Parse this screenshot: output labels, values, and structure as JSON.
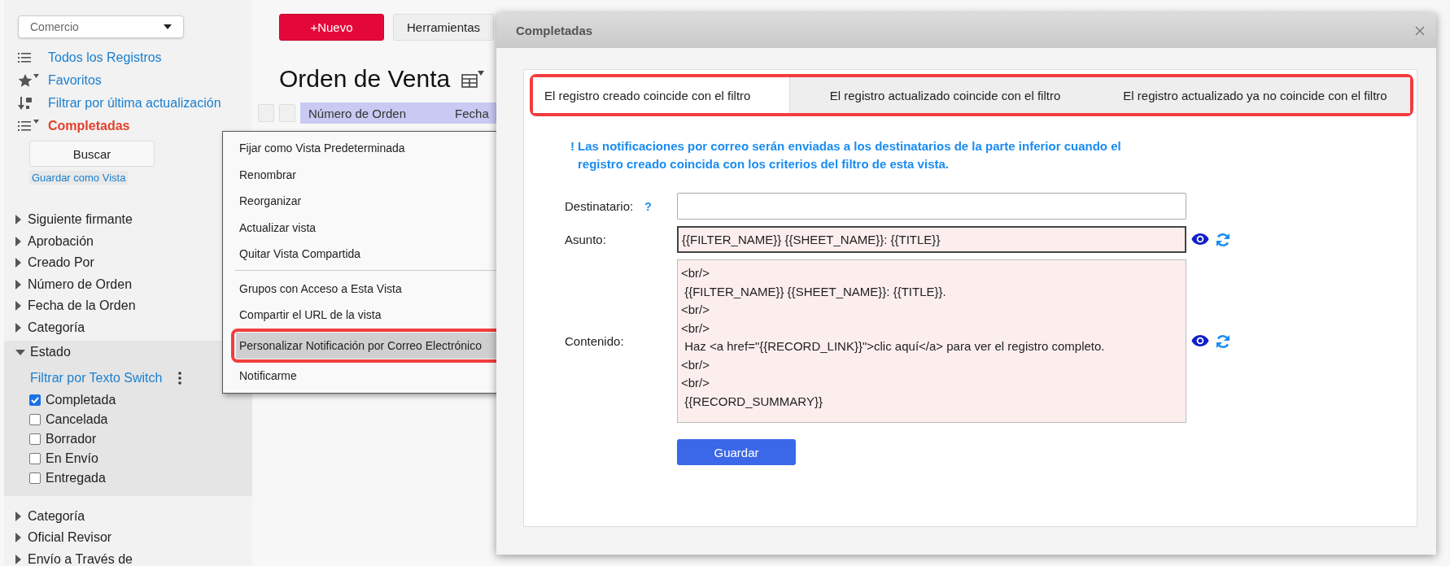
{
  "sidebar": {
    "app_select": {
      "value": "Comercio"
    },
    "views": [
      {
        "label": "Todos los Registros",
        "kind": "list",
        "selected": false
      },
      {
        "label": "Favoritos",
        "kind": "favorites",
        "selected": false
      },
      {
        "label": "Filtrar por última actualización",
        "kind": "sort",
        "selected": false
      },
      {
        "label": "Completadas",
        "kind": "filter-list",
        "selected": true
      }
    ],
    "search_button": "Buscar",
    "save_view_link": "Guardar como Vista",
    "filters": [
      {
        "label": "Siguiente firmante",
        "expanded": false
      },
      {
        "label": "Aprobación",
        "expanded": false
      },
      {
        "label": "Creado Por",
        "expanded": false
      },
      {
        "label": "Número de Orden",
        "expanded": false
      },
      {
        "label": "Fecha de la Orden",
        "expanded": false
      },
      {
        "label": "Categoría",
        "expanded": false
      },
      {
        "label": "Estado",
        "expanded": true,
        "filter_mode": "Filtrar por Texto Switch",
        "options": [
          {
            "label": "Completada",
            "checked": true
          },
          {
            "label": "Cancelada",
            "checked": false
          },
          {
            "label": "Borrador",
            "checked": false
          },
          {
            "label": "En Envío",
            "checked": false
          },
          {
            "label": "Entregada",
            "checked": false
          }
        ]
      },
      {
        "label": "Categoría",
        "expanded": false
      },
      {
        "label": "Oficial Revisor",
        "expanded": false
      },
      {
        "label": "Envío a Través de",
        "expanded": false
      }
    ]
  },
  "main": {
    "new_button": "+Nuevo",
    "tools_button": "Herramientas",
    "title": "Orden de Venta",
    "table_columns": [
      "Número de Orden",
      "Fecha"
    ]
  },
  "context_menu": {
    "groups": [
      [
        {
          "label": "Fijar como Vista Predeterminada",
          "selected": false
        },
        {
          "label": "Renombrar",
          "selected": false
        },
        {
          "label": "Reorganizar",
          "selected": false
        },
        {
          "label": "Actualizar vista",
          "selected": false
        },
        {
          "label": "Quitar Vista Compartida",
          "selected": false
        }
      ],
      [
        {
          "label": "Grupos con Acceso a Esta Vista",
          "selected": false
        },
        {
          "label": "Compartir el URL de la vista",
          "selected": false
        },
        {
          "label": "Personalizar Notificación por Correo Electrónico",
          "selected": true
        },
        {
          "label": "Notificarme",
          "selected": false
        }
      ]
    ]
  },
  "dialog": {
    "title": "Completadas",
    "tabs_highlighted": true,
    "tabs": [
      {
        "label": "El registro creado coincide con el filtro",
        "selected": true
      },
      {
        "label": "El registro actualizado coincide con el filtro",
        "selected": false
      },
      {
        "label": "El registro actualizado ya no coincide con el filtro",
        "selected": false
      }
    ],
    "notice_mark": "!",
    "notice": "Las notificaciones por correo serán enviadas a los destinatarios de la parte inferior cuando el registro creado coincida con los criterios del filtro de esta vista.",
    "fields": [
      {
        "label": "Destinatario:",
        "kind": "recipient",
        "help": "?"
      },
      {
        "label": "Asunto:",
        "kind": "subject",
        "value": "{{FILTER_NAME}} {{SHEET_NAME}}: {{TITLE}}"
      },
      {
        "label": "Contenido:",
        "kind": "content",
        "value": "<br/>\n {{FILTER_NAME}} {{SHEET_NAME}}: {{TITLE}}.\n<br/>\n<br/>\n Haz <a href=\"{{RECORD_LINK}}\">clic aquí</a> para ver el registro completo.\n<br/>\n<br/>\n {{RECORD_SUMMARY}}"
      }
    ],
    "save_button": "Guardar"
  }
}
